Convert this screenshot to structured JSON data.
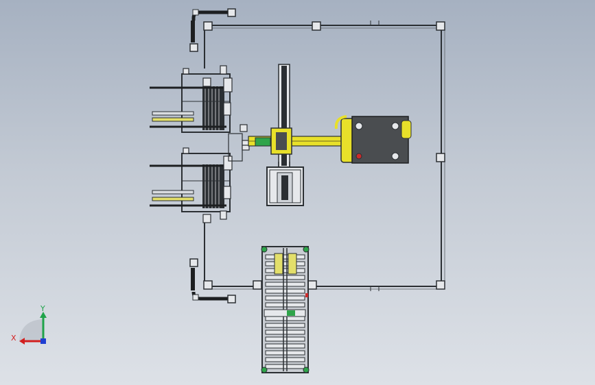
{
  "viewport": {
    "background_top": "#a6b1c1",
    "background_bottom": "#dde1e7"
  },
  "model": {
    "components": [
      "safety-fence",
      "robot-base",
      "robot-arm",
      "gripper-stand",
      "part-rack-top",
      "part-rack-bottom",
      "roller-conveyor",
      "fence-door-top",
      "fence-door-bottom"
    ],
    "colors": {
      "robot_body": "#e8e02a",
      "robot_motor": "#4a4d50",
      "frame_line": "#2b2f33",
      "fence_post": "#6e747a",
      "conveyor_green": "#2fa44a",
      "indicator_red": "#cc2b2b"
    }
  },
  "triad": {
    "x_label": "X",
    "y_label": "Y",
    "x_color": "#d21f1f",
    "y_color": "#1fa34a",
    "z_color": "#1f3fd2"
  }
}
